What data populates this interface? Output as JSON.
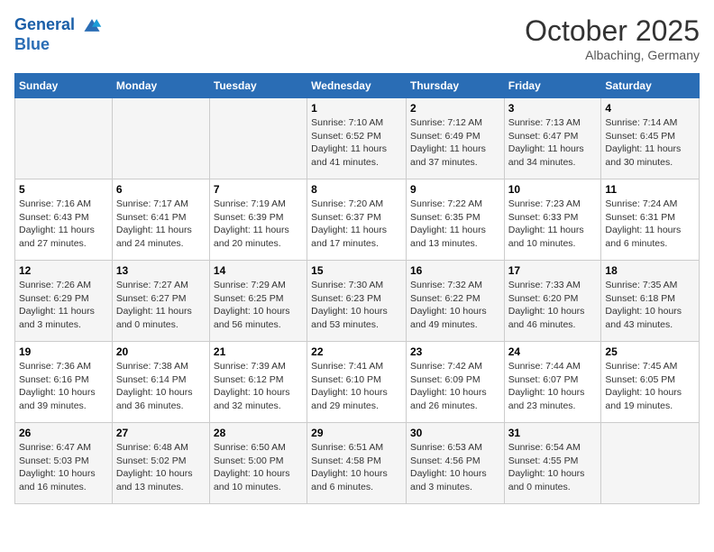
{
  "header": {
    "logo_line1": "General",
    "logo_line2": "Blue",
    "month": "October 2025",
    "location": "Albaching, Germany"
  },
  "days_of_week": [
    "Sunday",
    "Monday",
    "Tuesday",
    "Wednesday",
    "Thursday",
    "Friday",
    "Saturday"
  ],
  "weeks": [
    [
      {
        "day": "",
        "content": ""
      },
      {
        "day": "",
        "content": ""
      },
      {
        "day": "",
        "content": ""
      },
      {
        "day": "1",
        "content": "Sunrise: 7:10 AM\nSunset: 6:52 PM\nDaylight: 11 hours and 41 minutes."
      },
      {
        "day": "2",
        "content": "Sunrise: 7:12 AM\nSunset: 6:49 PM\nDaylight: 11 hours and 37 minutes."
      },
      {
        "day": "3",
        "content": "Sunrise: 7:13 AM\nSunset: 6:47 PM\nDaylight: 11 hours and 34 minutes."
      },
      {
        "day": "4",
        "content": "Sunrise: 7:14 AM\nSunset: 6:45 PM\nDaylight: 11 hours and 30 minutes."
      }
    ],
    [
      {
        "day": "5",
        "content": "Sunrise: 7:16 AM\nSunset: 6:43 PM\nDaylight: 11 hours and 27 minutes."
      },
      {
        "day": "6",
        "content": "Sunrise: 7:17 AM\nSunset: 6:41 PM\nDaylight: 11 hours and 24 minutes."
      },
      {
        "day": "7",
        "content": "Sunrise: 7:19 AM\nSunset: 6:39 PM\nDaylight: 11 hours and 20 minutes."
      },
      {
        "day": "8",
        "content": "Sunrise: 7:20 AM\nSunset: 6:37 PM\nDaylight: 11 hours and 17 minutes."
      },
      {
        "day": "9",
        "content": "Sunrise: 7:22 AM\nSunset: 6:35 PM\nDaylight: 11 hours and 13 minutes."
      },
      {
        "day": "10",
        "content": "Sunrise: 7:23 AM\nSunset: 6:33 PM\nDaylight: 11 hours and 10 minutes."
      },
      {
        "day": "11",
        "content": "Sunrise: 7:24 AM\nSunset: 6:31 PM\nDaylight: 11 hours and 6 minutes."
      }
    ],
    [
      {
        "day": "12",
        "content": "Sunrise: 7:26 AM\nSunset: 6:29 PM\nDaylight: 11 hours and 3 minutes."
      },
      {
        "day": "13",
        "content": "Sunrise: 7:27 AM\nSunset: 6:27 PM\nDaylight: 11 hours and 0 minutes."
      },
      {
        "day": "14",
        "content": "Sunrise: 7:29 AM\nSunset: 6:25 PM\nDaylight: 10 hours and 56 minutes."
      },
      {
        "day": "15",
        "content": "Sunrise: 7:30 AM\nSunset: 6:23 PM\nDaylight: 10 hours and 53 minutes."
      },
      {
        "day": "16",
        "content": "Sunrise: 7:32 AM\nSunset: 6:22 PM\nDaylight: 10 hours and 49 minutes."
      },
      {
        "day": "17",
        "content": "Sunrise: 7:33 AM\nSunset: 6:20 PM\nDaylight: 10 hours and 46 minutes."
      },
      {
        "day": "18",
        "content": "Sunrise: 7:35 AM\nSunset: 6:18 PM\nDaylight: 10 hours and 43 minutes."
      }
    ],
    [
      {
        "day": "19",
        "content": "Sunrise: 7:36 AM\nSunset: 6:16 PM\nDaylight: 10 hours and 39 minutes."
      },
      {
        "day": "20",
        "content": "Sunrise: 7:38 AM\nSunset: 6:14 PM\nDaylight: 10 hours and 36 minutes."
      },
      {
        "day": "21",
        "content": "Sunrise: 7:39 AM\nSunset: 6:12 PM\nDaylight: 10 hours and 32 minutes."
      },
      {
        "day": "22",
        "content": "Sunrise: 7:41 AM\nSunset: 6:10 PM\nDaylight: 10 hours and 29 minutes."
      },
      {
        "day": "23",
        "content": "Sunrise: 7:42 AM\nSunset: 6:09 PM\nDaylight: 10 hours and 26 minutes."
      },
      {
        "day": "24",
        "content": "Sunrise: 7:44 AM\nSunset: 6:07 PM\nDaylight: 10 hours and 23 minutes."
      },
      {
        "day": "25",
        "content": "Sunrise: 7:45 AM\nSunset: 6:05 PM\nDaylight: 10 hours and 19 minutes."
      }
    ],
    [
      {
        "day": "26",
        "content": "Sunrise: 6:47 AM\nSunset: 5:03 PM\nDaylight: 10 hours and 16 minutes."
      },
      {
        "day": "27",
        "content": "Sunrise: 6:48 AM\nSunset: 5:02 PM\nDaylight: 10 hours and 13 minutes."
      },
      {
        "day": "28",
        "content": "Sunrise: 6:50 AM\nSunset: 5:00 PM\nDaylight: 10 hours and 10 minutes."
      },
      {
        "day": "29",
        "content": "Sunrise: 6:51 AM\nSunset: 4:58 PM\nDaylight: 10 hours and 6 minutes."
      },
      {
        "day": "30",
        "content": "Sunrise: 6:53 AM\nSunset: 4:56 PM\nDaylight: 10 hours and 3 minutes."
      },
      {
        "day": "31",
        "content": "Sunrise: 6:54 AM\nSunset: 4:55 PM\nDaylight: 10 hours and 0 minutes."
      },
      {
        "day": "",
        "content": ""
      }
    ]
  ]
}
